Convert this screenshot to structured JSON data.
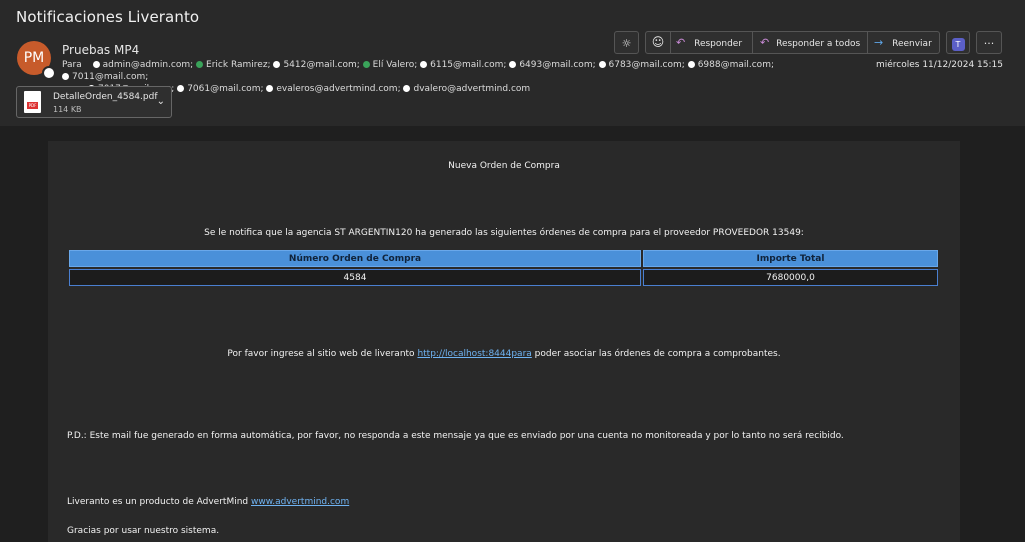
{
  "email": {
    "subject": "Notificaciones Liveranto",
    "avatar_initials": "PM",
    "sender": "Pruebas MP4",
    "to_label": "Para",
    "recipients_line1": [
      {
        "name": "admin@admin.com;",
        "status": "white"
      },
      {
        "name": "Erick Ramirez;",
        "status": "green"
      },
      {
        "name": "5412@mail.com;",
        "status": "white"
      },
      {
        "name": "Elí Valero;",
        "status": "green"
      },
      {
        "name": "6115@mail.com;",
        "status": "white"
      },
      {
        "name": "6493@mail.com;",
        "status": "white"
      },
      {
        "name": "6783@mail.com;",
        "status": "white"
      },
      {
        "name": "6988@mail.com;",
        "status": "white"
      },
      {
        "name": "7011@mail.com;",
        "status": "white"
      }
    ],
    "recipients_line2": [
      {
        "name": "7017@mail.com;",
        "status": "white"
      },
      {
        "name": "7061@mail.com;",
        "status": "white"
      },
      {
        "name": "evaleros@advertmind.com;",
        "status": "white"
      },
      {
        "name": "dvalero@advertmind.com",
        "status": "white"
      }
    ],
    "date": "miércoles 11/12/2024 15:15"
  },
  "toolbar": {
    "reply": "Responder",
    "reply_all": "Responder a todos",
    "forward": "Reenviar",
    "more": "···"
  },
  "attachment": {
    "name": "DetalleOrden_4584.pdf",
    "size": "114 KB",
    "badge": "PDF"
  },
  "message": {
    "heading": "Nueva Orden de Compra",
    "intro": "Se le notifica que la agencia ST ARGENTIN120 ha generado las siguientes órdenes de compra para el proveedor PROVEEDOR 13549:",
    "table": {
      "headers": [
        "Número Orden de Compra",
        "Importe Total"
      ],
      "rows": [
        [
          "4584",
          "7680000,0"
        ]
      ]
    },
    "cta_before": "Por favor ingrese al sitio web de liveranto ",
    "cta_link": "http://localhost:8444para",
    "cta_after": " poder asociar las órdenes de compra a comprobantes.",
    "ps": "P.D.: Este mail fue generado en forma automática, por favor, no responda a este mensaje ya que es enviado por una cuenta no monitoreada y por lo tanto no será recibido.",
    "product_before": "Liveranto es un producto de AdvertMind ",
    "product_link": "www.advertmind.com",
    "thanks": "Gracias por usar nuestro sistema."
  },
  "colors": {
    "table_header": "#4a90d9",
    "avatar": "#c75b2b",
    "link": "#6fb3f2"
  }
}
